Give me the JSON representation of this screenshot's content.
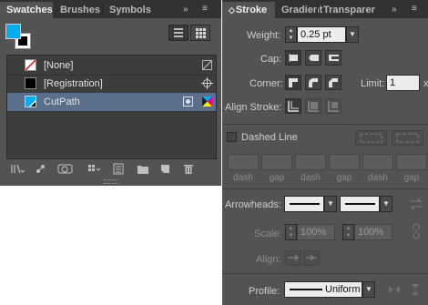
{
  "swatches_panel": {
    "tabs": [
      "Swatches",
      "Brushes",
      "Symbols"
    ],
    "menu_controls": [
      "»",
      "≡"
    ],
    "swatches": [
      {
        "name": "[None]",
        "color": "none",
        "type_icon": "none-icon"
      },
      {
        "name": "[Registration]",
        "color": "#000000",
        "type_icon": "registration-icon"
      },
      {
        "name": "CutPath",
        "color": "#00aeef",
        "type_icon": "spot-color-icon",
        "selected": true
      }
    ],
    "fill_color": "#00aeef",
    "stroke_color": "#000000",
    "footer_icons": [
      "swatch-libraries-icon",
      "place-swatches-icon",
      "color-group-icon",
      "show-kinds-icon",
      "swatch-options-icon",
      "new-color-group-icon",
      "new-swatch-icon",
      "delete-swatch-icon"
    ]
  },
  "stroke_panel": {
    "tabs": [
      "Stroke",
      "Gradient",
      "Transparency"
    ],
    "tab_prefix": "◇",
    "menu_controls": [
      "»",
      "≡"
    ],
    "weight_label": "Weight:",
    "weight_value": "0.25 pt",
    "cap_label": "Cap:",
    "corner_label": "Corner:",
    "limit_label": "Limit:",
    "limit_value": "1",
    "limit_unit": "x",
    "align_stroke_label": "Align Stroke:",
    "dashed_line_label": "Dashed Line",
    "dashed_line_checked": false,
    "dash_gap_labels": [
      "dash",
      "gap",
      "dash",
      "gap",
      "dash",
      "gap"
    ],
    "arrowheads_label": "Arrowheads:",
    "scale_label": "Scale:",
    "scale_start": "100%",
    "scale_end": "100%",
    "align_label": "Align:",
    "profile_label": "Profile:",
    "profile_value": "Uniform"
  }
}
